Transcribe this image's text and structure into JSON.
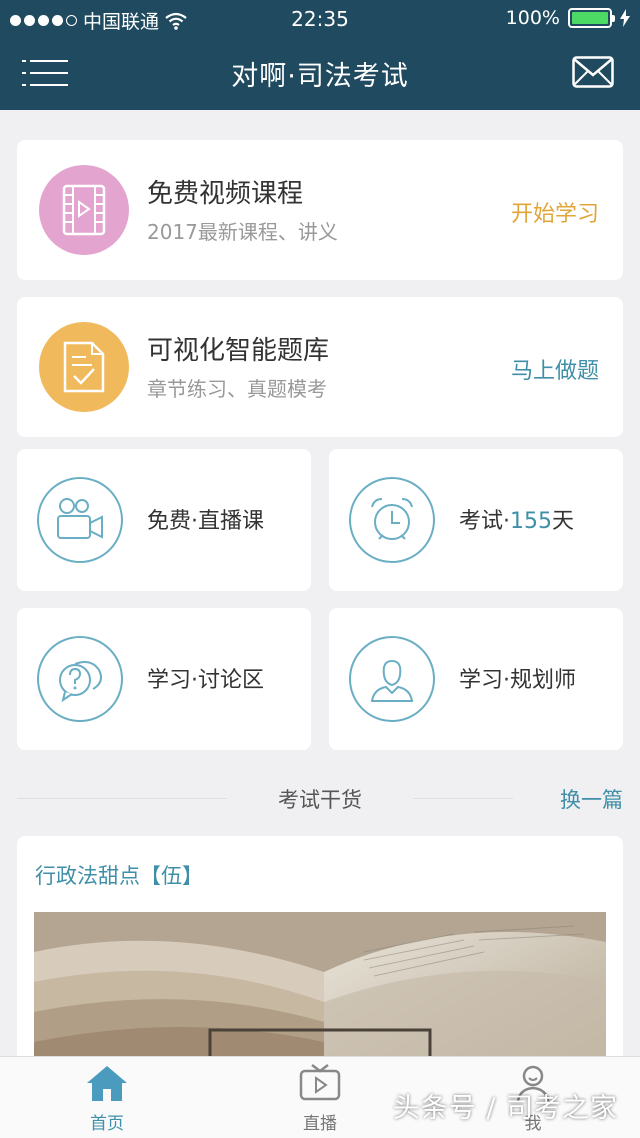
{
  "status": {
    "carrier": "中国联通",
    "time": "22:35",
    "battery": "100%"
  },
  "nav": {
    "title": "对啊·司法考试"
  },
  "cards": {
    "video": {
      "title": "免费视频课程",
      "subtitle": "2017最新课程、讲义",
      "action": "开始学习",
      "color": "#e3a5cf",
      "action_color": "#e0a63a"
    },
    "bank": {
      "title": "可视化智能题库",
      "subtitle": "章节练习、真题模考",
      "action": "马上做题",
      "color": "#f0b95b",
      "action_color": "#3f8fa8"
    }
  },
  "grid": {
    "live": {
      "label": "免费·直播课"
    },
    "exam": {
      "label_prefix": "考试·",
      "days": "155",
      "label_suffix": "天"
    },
    "discuss": {
      "label": "学习·讨论区"
    },
    "planner": {
      "label": "学习·规划师"
    }
  },
  "section": {
    "title": "考试干货",
    "swap": "换一篇"
  },
  "article": {
    "title": "行政法甜点【伍】"
  },
  "tabs": [
    {
      "label": "首页",
      "active": true
    },
    {
      "label": "直播",
      "active": false
    },
    {
      "label": "我",
      "active": false
    }
  ],
  "watermark": "头条号 / 司考之家"
}
